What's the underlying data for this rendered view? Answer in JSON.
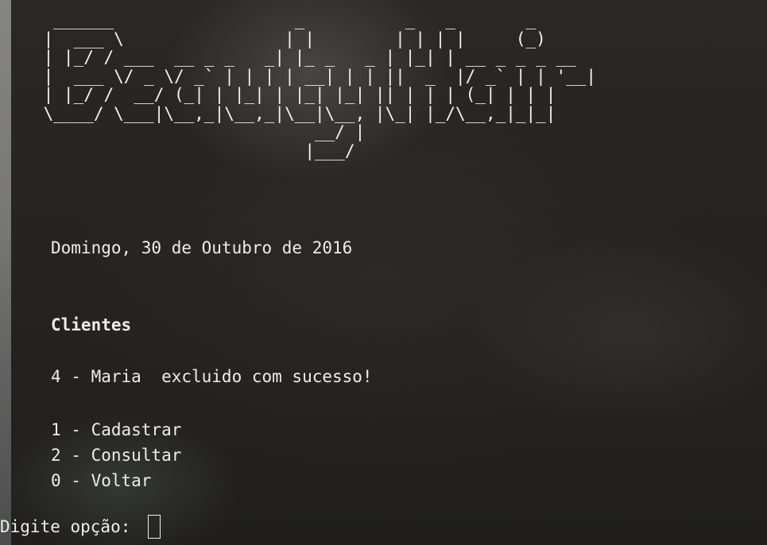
{
  "banner": {
    "ascii_art": "  ______                  _          _   _       _ \n |  ___ \\                | |        | | | |     (_)\n | |_/ / ___  __ _ _   _| |_ _   _ | |_| | __ _ _ _ __\n |  ___ \\/ _ \\/ _` | | | | __| | | ||  _  |/ _` | | '__|\n | |_/ /  __/ (_| | |_| | |_| |_| || | | | (_| | | |\n \\____/ \\___|\\__,_|\\__,_|\\__|\\__, |\\_| |_/\\__,_|_|_|\n                            __/ |\n                           |___/"
  },
  "date_text": "Domingo, 30 de Outubro de 2016",
  "section_title": "Clientes",
  "status_message": "4 - Maria  excluido com sucesso!",
  "menu": {
    "items": [
      {
        "label": "1 - Cadastrar"
      },
      {
        "label": "2 - Consultar"
      },
      {
        "label": "0 - Voltar"
      }
    ]
  },
  "prompt": {
    "label": "Digite opção: "
  }
}
